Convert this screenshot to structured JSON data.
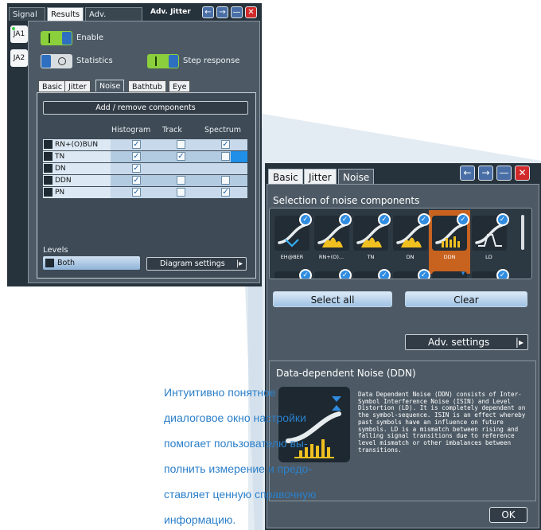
{
  "dialog1": {
    "tabs": [
      "Signal",
      "Results",
      "Adv. settings"
    ],
    "active_tab": "Results",
    "title": "Adv. Jitter",
    "side_tabs": [
      "JA1",
      "JA2"
    ],
    "enable_label": "Enable",
    "statistics_label": "Statistics",
    "step_response_label": "Step response",
    "sub_tabs": [
      "Basic",
      "Jitter",
      "Noise",
      "Bathtub",
      "Eye"
    ],
    "active_sub_tab": "Noise",
    "add_remove_label": "Add / remove components",
    "columns": [
      "Histogram",
      "Track",
      "Spectrum"
    ],
    "rows": [
      {
        "label": "RN+(O)BUN",
        "histogram": true,
        "track": false,
        "spectrum": true
      },
      {
        "label": "TN",
        "histogram": true,
        "track": true,
        "spectrum": false
      },
      {
        "label": "DN",
        "histogram": true,
        "track": null,
        "spectrum": null
      },
      {
        "label": "DDN",
        "histogram": true,
        "track": false,
        "spectrum": false
      },
      {
        "label": "PN",
        "histogram": true,
        "track": false,
        "spectrum": true
      }
    ],
    "levels_label": "Levels",
    "levels_value": "Both",
    "diagram_settings_label": "Diagram settings"
  },
  "dialog2": {
    "tabs": [
      "Basic",
      "Jitter",
      "Noise"
    ],
    "active_tab": "Noise",
    "section_title": "Selection of noise components",
    "components": [
      {
        "caption": "EH@BER",
        "icon": "eye-height-icon",
        "selected": false
      },
      {
        "caption": "RN+(O)...",
        "icon": "random-noise-icon",
        "selected": false
      },
      {
        "caption": "TN",
        "icon": "total-noise-icon",
        "selected": false
      },
      {
        "caption": "DN",
        "icon": "deterministic-noise-icon",
        "selected": false
      },
      {
        "caption": "DDN",
        "icon": "data-dependent-noise-icon",
        "selected": true
      },
      {
        "caption": "LD",
        "icon": "level-distortion-icon",
        "selected": false
      }
    ],
    "select_all_label": "Select all",
    "clear_label": "Clear",
    "adv_settings_label": "Adv. settings",
    "info_title": "Data-dependent Noise (DDN)",
    "info_text": "Data Dependent Noise (DDN) consists of Inter-Symbol Interference Noise (ISIN) and Level Distortion (LD). It is completely dependent on the symbol-sequence. ISIN is an effect whereby past symbols have an influence on future symbols. LD is a mismatch between rising and falling signal transitions due to reference level mismatch or other imbalances between transitions.",
    "ok_label": "OK"
  },
  "caption_lines": [
    "Интуитивно понятное",
    "диалоговое окно настройки",
    "помогает пользователю вы-",
    "полнить измерение и предо-",
    "ставляет ценную справочную",
    "информацию."
  ],
  "colors": {
    "accent": "#2f8ce0",
    "selected": "#c8631f",
    "caption": "#2b7fc9",
    "toggle_on": "#8ccf3c"
  }
}
